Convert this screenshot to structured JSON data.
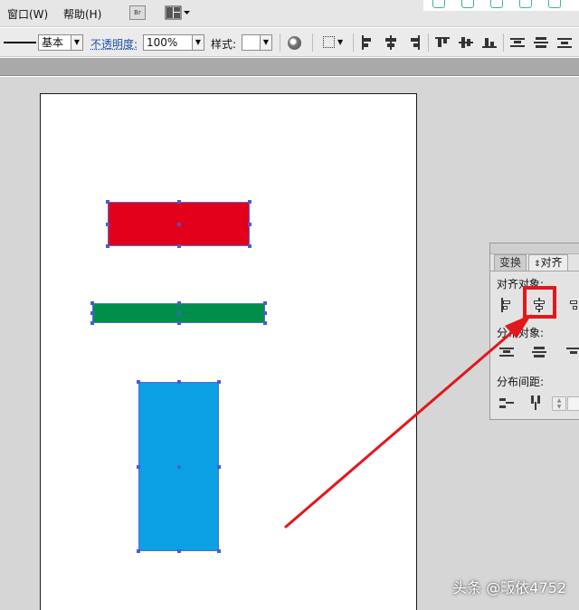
{
  "menubar": {
    "items": [
      "窗口(W)",
      "帮助(H)"
    ],
    "bridge_label": "Br"
  },
  "controlbar": {
    "stroke_profile": "基本",
    "opacity_label": "不透明度:",
    "opacity_value": "100%",
    "style_label": "样式:"
  },
  "canvas": {
    "shapes": [
      {
        "name": "red-rectangle",
        "color": "#e3001b"
      },
      {
        "name": "green-rectangle",
        "color": "#008f4a"
      },
      {
        "name": "blue-rectangle",
        "color": "#0b9fe4"
      }
    ]
  },
  "align_panel": {
    "tabs": [
      "变换",
      "对齐"
    ],
    "active_tab": "对齐",
    "align_objects_label": "对齐对象:",
    "distribute_objects_label": "分布对象:",
    "distribute_spacing_label": "分布间距:",
    "highlighted_button": "horizontal-align-center"
  },
  "annotation": {
    "arrow_color": "#e2181c",
    "highlight_color": "#e2181c"
  },
  "watermark": "头条 @畈依4752"
}
